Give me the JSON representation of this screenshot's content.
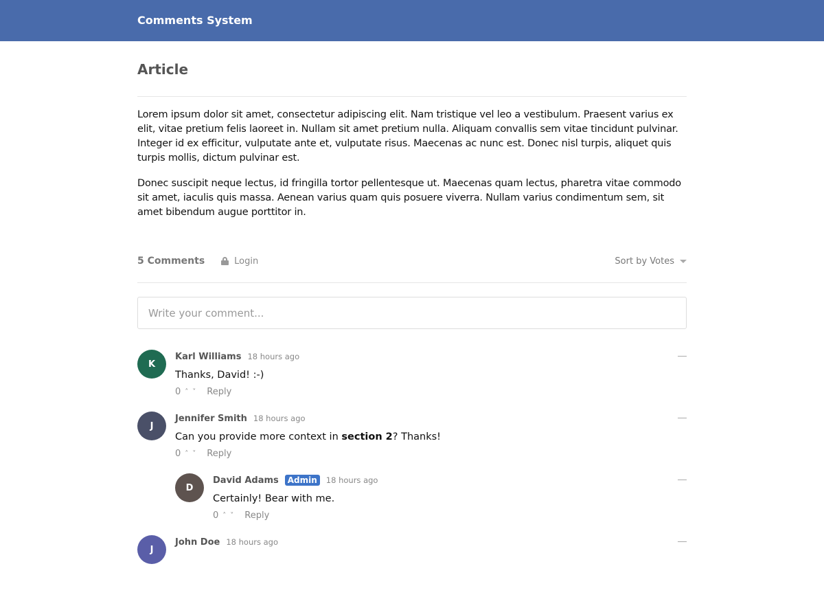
{
  "app": {
    "title": "Comments System"
  },
  "article": {
    "title": "Article",
    "paragraphs": [
      "Lorem ipsum dolor sit amet, consectetur adipiscing elit. Nam tristique vel leo a vestibulum. Praesent varius ex elit, vitae pretium felis laoreet in. Nullam sit amet pretium nulla. Aliquam convallis sem vitae tincidunt pulvinar. Integer id ex efficitur, vulputate ante et, vulputate risus. Maecenas ac nunc est. Donec nisl turpis, aliquet quis turpis mollis, dictum pulvinar est.",
      "Donec suscipit neque lectus, id fringilla tortor pellentesque ut. Maecenas quam lectus, pharetra vitae commodo sit amet, iaculis quis massa. Aenean varius quam quis posuere viverra. Nullam varius condimentum sem, sit amet bibendum augue porttitor in."
    ]
  },
  "comments_bar": {
    "count_label": "5 Comments",
    "login_label": "Login",
    "sort_label": "Sort by Votes"
  },
  "composer": {
    "placeholder": "Write your comment..."
  },
  "comments": [
    {
      "initial": "K",
      "name": "Karl Williams",
      "time": "18 hours ago",
      "text_before": "Thanks, David! :-)",
      "bold": "",
      "text_after": "",
      "votes": "0",
      "reply": "Reply",
      "color": "#1f6b52"
    },
    {
      "initial": "J",
      "name": "Jennifer Smith",
      "time": "18 hours ago",
      "text_before": "Can you provide more context in ",
      "bold": "section 2",
      "text_after": "? Thanks!",
      "votes": "0",
      "reply": "Reply",
      "color": "#4a5068"
    },
    {
      "initial": "D",
      "name": "David Adams",
      "badge": "Admin",
      "time": "18 hours ago",
      "text_before": "Certainly! Bear with me.",
      "bold": "",
      "text_after": "",
      "votes": "0",
      "reply": "Reply",
      "color": "#5e534f",
      "nested": true
    },
    {
      "initial": "J",
      "name": "John Doe",
      "time": "18 hours ago",
      "text_before": "",
      "bold": "",
      "text_after": "",
      "votes": "",
      "reply": "",
      "color": "#5a5ea8"
    }
  ],
  "colors": {
    "header": "#496bab",
    "admin_badge": "#3d74c8"
  }
}
